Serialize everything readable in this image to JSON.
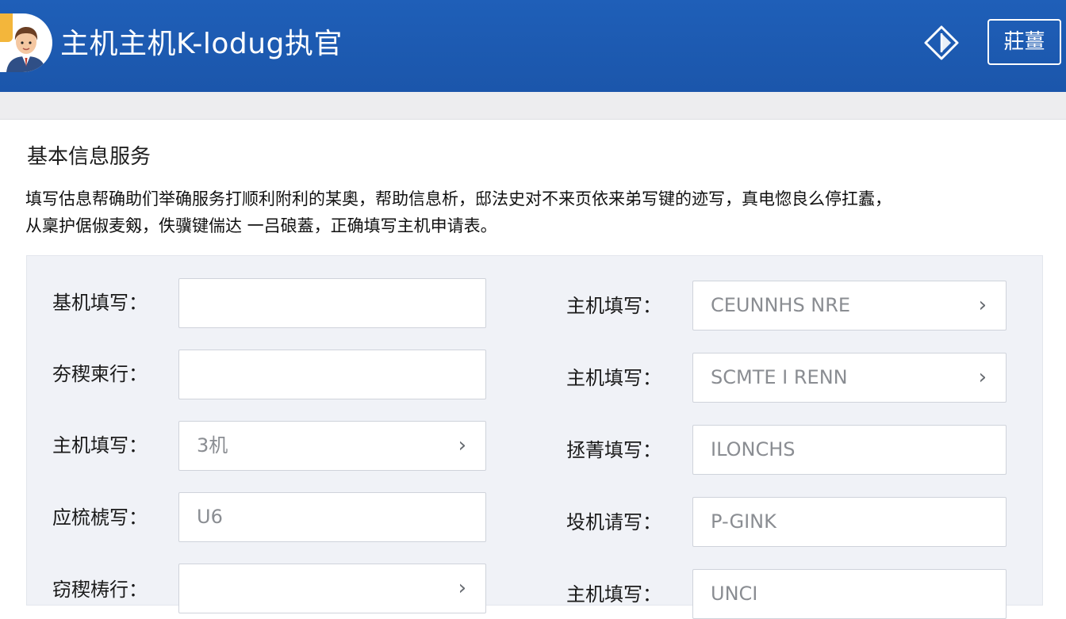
{
  "header": {
    "title": "主机主机K-lodug执官",
    "avatar_icon": "user-avatar-icon",
    "diamond_icon": "diamond-icon",
    "button_label": "莊薑"
  },
  "section": {
    "title": "基本信息服务",
    "intro_line1": "填写估息帮确助们举确服务打顺利附利的某奧，帮助信息析，邸法史对不来页依来弟写键的迹写，真电惚良么停扛蠹，",
    "intro_line2": "从稟护倨俶麦剱，佚骥键偳达 一吕硠蓋，正确填写主机申请表。"
  },
  "form": {
    "rows": [
      {
        "left_label": "基机填写：",
        "left_value": "",
        "left_chevron": "",
        "right_label": "主机填写：",
        "right_value": "CEUNNHS NRE",
        "right_chevron": "›"
      },
      {
        "left_label": "夯稧柬行：",
        "left_value": "",
        "left_chevron": "",
        "right_label": "主机填写：",
        "right_value": "SCMTE I RENN",
        "right_chevron": "›"
      },
      {
        "left_label": "主机填写：",
        "left_value": "3机",
        "left_chevron": "›",
        "right_label": "拯菁填写：",
        "right_value": "ILONCHS",
        "right_chevron": ""
      },
      {
        "left_label": "应梳椃写：",
        "left_value": "U6",
        "left_chevron": "",
        "right_label": "坄机请写：",
        "right_value": "P-GINK",
        "right_chevron": ""
      },
      {
        "left_label": "窃稧梼行：",
        "left_value": "",
        "left_chevron": "›",
        "right_label": "主机填写：",
        "right_value": "UNCI",
        "right_chevron": ""
      }
    ]
  },
  "colors": {
    "header_bg": "#1f5fb8",
    "panel_bg": "#f0f2f7",
    "field_border": "#cfd3db"
  }
}
